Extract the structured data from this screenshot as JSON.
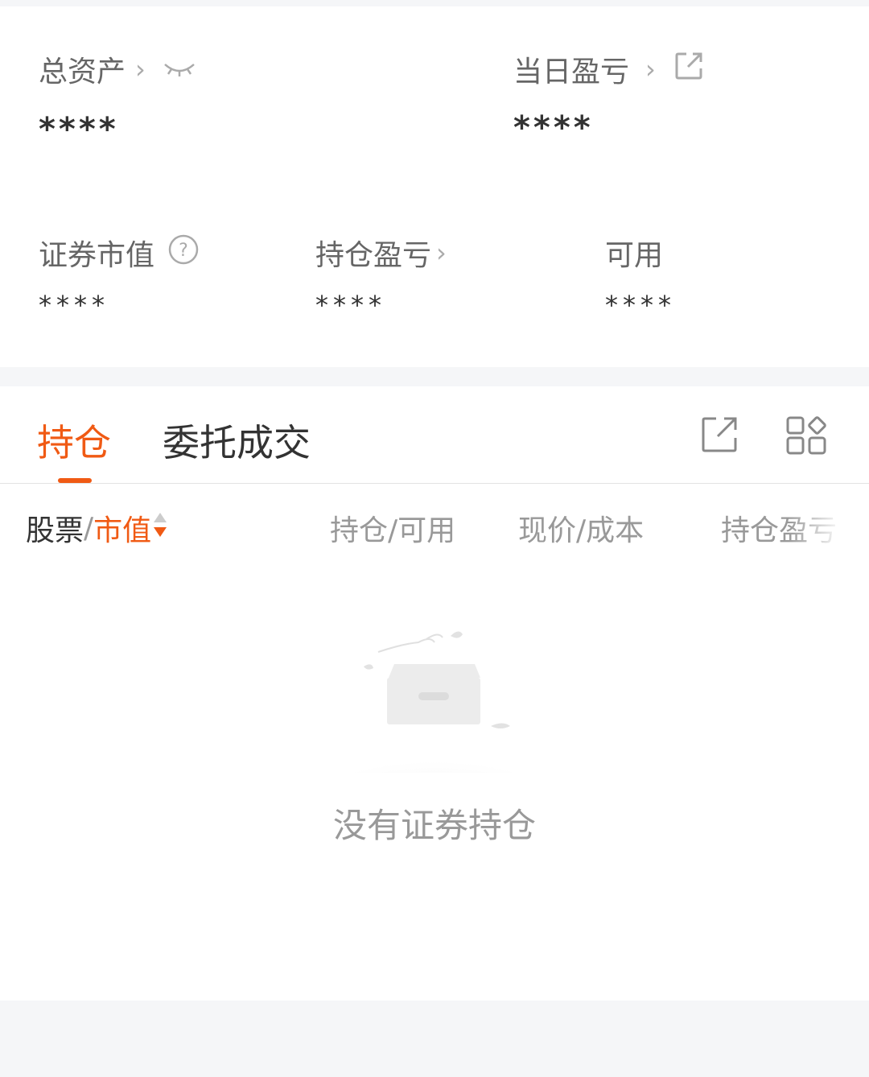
{
  "assets": {
    "total": {
      "label": "总资产",
      "value": "****"
    },
    "daily_pl": {
      "label": "当日盈亏",
      "value": "****"
    },
    "market_value": {
      "label": "证券市值",
      "value": "****"
    },
    "position_pl": {
      "label": "持仓盈亏",
      "value": "****"
    },
    "available": {
      "label": "可用",
      "value": "****"
    }
  },
  "tabs": [
    {
      "label": "持仓",
      "active": true
    },
    {
      "label": "委托成交",
      "active": false
    }
  ],
  "columns": {
    "stock": "股票",
    "separator": "/",
    "market_value": "市值",
    "position_available": "持仓/可用",
    "price_cost": "现价/成本",
    "position_pl": "持仓盈亏"
  },
  "empty_state": {
    "text": "没有证券持仓"
  },
  "colors": {
    "accent": "#f05a14",
    "muted": "#999999",
    "text": "#333333",
    "background": "#f5f6f8"
  },
  "icons": {
    "chevron": "chevron-right-icon",
    "eye": "eye-closed-icon",
    "share": "external-link-icon",
    "help": "question-circle-icon",
    "grid": "grid-layout-icon"
  }
}
